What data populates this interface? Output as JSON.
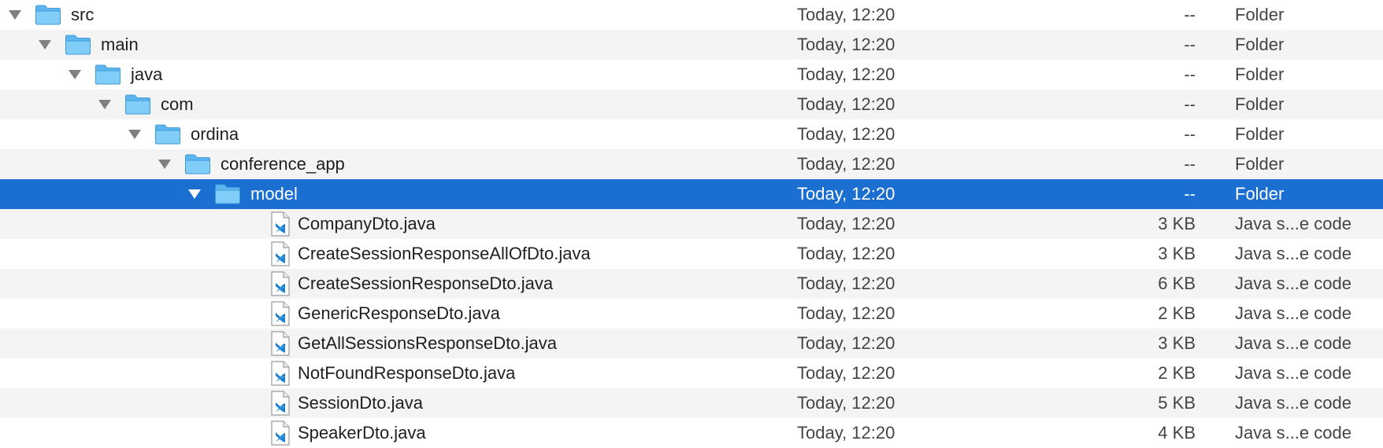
{
  "colors": {
    "selection": "#1a6fd1",
    "folder": "#6ec3f4",
    "stripe": "#f4f4f4",
    "vscode_blue": "#1f7fcf"
  },
  "rows": [
    {
      "name": "src",
      "date": "Today, 12:20",
      "size": "--",
      "kind": "Folder",
      "type": "folder",
      "depth": 0,
      "expanded": true,
      "selected": false,
      "icon": "folder-icon"
    },
    {
      "name": "main",
      "date": "Today, 12:20",
      "size": "--",
      "kind": "Folder",
      "type": "folder",
      "depth": 1,
      "expanded": true,
      "selected": false,
      "icon": "folder-icon"
    },
    {
      "name": "java",
      "date": "Today, 12:20",
      "size": "--",
      "kind": "Folder",
      "type": "folder",
      "depth": 2,
      "expanded": true,
      "selected": false,
      "icon": "folder-icon"
    },
    {
      "name": "com",
      "date": "Today, 12:20",
      "size": "--",
      "kind": "Folder",
      "type": "folder",
      "depth": 3,
      "expanded": true,
      "selected": false,
      "icon": "folder-icon"
    },
    {
      "name": "ordina",
      "date": "Today, 12:20",
      "size": "--",
      "kind": "Folder",
      "type": "folder",
      "depth": 4,
      "expanded": true,
      "selected": false,
      "icon": "folder-icon"
    },
    {
      "name": "conference_app",
      "date": "Today, 12:20",
      "size": "--",
      "kind": "Folder",
      "type": "folder",
      "depth": 5,
      "expanded": true,
      "selected": false,
      "icon": "folder-icon"
    },
    {
      "name": "model",
      "date": "Today, 12:20",
      "size": "--",
      "kind": "Folder",
      "type": "folder",
      "depth": 6,
      "expanded": true,
      "selected": true,
      "icon": "folder-icon"
    },
    {
      "name": "CompanyDto.java",
      "date": "Today, 12:20",
      "size": "3 KB",
      "kind": "Java s...e code",
      "type": "file",
      "depth": 7,
      "selected": false,
      "icon": "java-file-icon"
    },
    {
      "name": "CreateSessionResponseAllOfDto.java",
      "date": "Today, 12:20",
      "size": "3 KB",
      "kind": "Java s...e code",
      "type": "file",
      "depth": 7,
      "selected": false,
      "icon": "java-file-icon"
    },
    {
      "name": "CreateSessionResponseDto.java",
      "date": "Today, 12:20",
      "size": "6 KB",
      "kind": "Java s...e code",
      "type": "file",
      "depth": 7,
      "selected": false,
      "icon": "java-file-icon"
    },
    {
      "name": "GenericResponseDto.java",
      "date": "Today, 12:20",
      "size": "2 KB",
      "kind": "Java s...e code",
      "type": "file",
      "depth": 7,
      "selected": false,
      "icon": "java-file-icon"
    },
    {
      "name": "GetAllSessionsResponseDto.java",
      "date": "Today, 12:20",
      "size": "3 KB",
      "kind": "Java s...e code",
      "type": "file",
      "depth": 7,
      "selected": false,
      "icon": "java-file-icon"
    },
    {
      "name": "NotFoundResponseDto.java",
      "date": "Today, 12:20",
      "size": "2 KB",
      "kind": "Java s...e code",
      "type": "file",
      "depth": 7,
      "selected": false,
      "icon": "java-file-icon"
    },
    {
      "name": "SessionDto.java",
      "date": "Today, 12:20",
      "size": "5 KB",
      "kind": "Java s...e code",
      "type": "file",
      "depth": 7,
      "selected": false,
      "icon": "java-file-icon"
    },
    {
      "name": "SpeakerDto.java",
      "date": "Today, 12:20",
      "size": "4 KB",
      "kind": "Java s...e code",
      "type": "file",
      "depth": 7,
      "selected": false,
      "icon": "java-file-icon"
    }
  ]
}
